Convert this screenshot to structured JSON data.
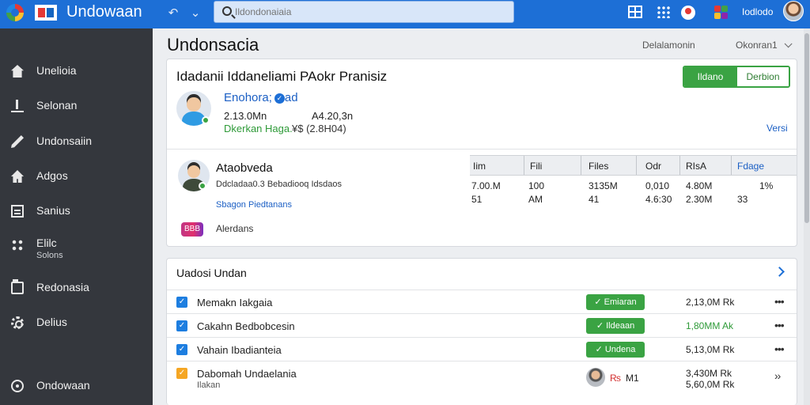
{
  "app": {
    "title": "Undowaan"
  },
  "topbar": {
    "search_placeholder": "Ildondonaiaia",
    "user_name": "Iodlodo"
  },
  "sidebar": {
    "items": [
      {
        "label": "Unelioia",
        "icon": "home-icon"
      },
      {
        "label": "Selonan",
        "icon": "upload-icon"
      },
      {
        "label": "Undonsaiin",
        "icon": "pen-icon"
      },
      {
        "label": "Adgos",
        "icon": "house-icon"
      },
      {
        "label": "Sanius",
        "icon": "list-icon"
      },
      {
        "label": "Elilc",
        "sub": "Solons",
        "icon": "network-icon"
      },
      {
        "label": "Redonasia",
        "icon": "folder-icon"
      },
      {
        "label": "Delius",
        "icon": "gear-icon"
      },
      {
        "label": "Ondowaan",
        "icon": "circle-icon"
      }
    ]
  },
  "header": {
    "title": "Undonsacia",
    "link1": "Delalamonin",
    "link2": "Okonran1"
  },
  "profile_card": {
    "title": "Idadanii Iddaneliami PAokr Pranisiz",
    "toggle_on": "Ildano",
    "toggle_off": "Derbion",
    "user1": {
      "name": "Enohora;",
      "name_suffix": "ad",
      "stat1": "2.13.0Mn",
      "stat2": "A4.20,3n",
      "status": "Dkerkan Haga.",
      "status_value": "¥$ (2.8H04)",
      "versi": "Versi"
    },
    "user2": {
      "name": "Ataobveda",
      "desc": "Ddcladaa0.3 Bebadiooq Idsdaos",
      "link": "Sbagon Piedtanans",
      "badge": "BBB",
      "foot": "Alerdans"
    },
    "stats": {
      "headers": [
        "Iim",
        "Fili",
        "Files",
        "Odr",
        "RIsA",
        "Fdage"
      ],
      "row1": [
        "7.00.M",
        "100",
        "3135M",
        "0,010",
        "4.80M",
        "1%"
      ],
      "row2": [
        "51",
        "AM",
        "41",
        "4.6:30",
        "2.30M",
        "33"
      ]
    }
  },
  "list_card": {
    "title": "Uadosi Undan",
    "rows": [
      {
        "title": "Memakn Iakgaia",
        "badge": "Emiaran",
        "value": "2,13,0M Rk",
        "value_color": "#222222"
      },
      {
        "title": "Cakahn Bedbobcesin",
        "badge": "Ildeaan",
        "value": "1,80MM Ak",
        "value_color": "#2e9a38"
      },
      {
        "title": "Vahain Ibadianteia",
        "badge": "Undena",
        "value": "5,13,0M Rk",
        "value_color": "#222222"
      },
      {
        "title": "Dabomah Undaelania",
        "sub": "Ilakan",
        "currency": "₨",
        "m": "M1",
        "value": "3,430M Rk",
        "value2": "5,60,0M Rk",
        "value_color": "#222222"
      }
    ]
  },
  "colors": {
    "accent": "#1d6fd6",
    "sidebar": "#34373d",
    "success": "#3aa343"
  }
}
